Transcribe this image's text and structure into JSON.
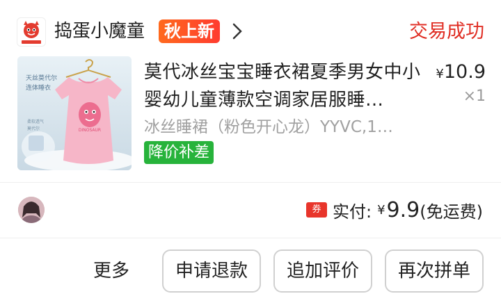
{
  "shop": {
    "name": "捣蛋小魔童",
    "badge": "秋上新",
    "status": "交易成功",
    "logo_icon": "devil-mascot-icon"
  },
  "product": {
    "title": "莫代冰丝宝宝睡衣裙夏季男女中小婴幼儿童薄款空调家居服睡…",
    "price_symbol": "¥",
    "price": "10.9",
    "quantity": "×1",
    "sku": "冰丝睡裙（粉色开心龙）YYVC,1…",
    "tag": "降价补差",
    "image_text_1": "天丝莫代尔",
    "image_text_2": "连体睡衣",
    "image_text_3": "柔软透气",
    "image_text_4": "莫代尔",
    "image_text_5": "DINOSAUR"
  },
  "payment": {
    "coupon_label": "券",
    "label": "实付:",
    "symbol": "¥",
    "amount": "9.9",
    "shipping": "(免运费)"
  },
  "actions": {
    "more": "更多",
    "refund": "申请退款",
    "review": "追加评价",
    "reorder": "再次拼单"
  },
  "colors": {
    "accent_red": "#e02e24",
    "badge_orange": "#ff5a1f",
    "tag_green": "#27b33b"
  }
}
